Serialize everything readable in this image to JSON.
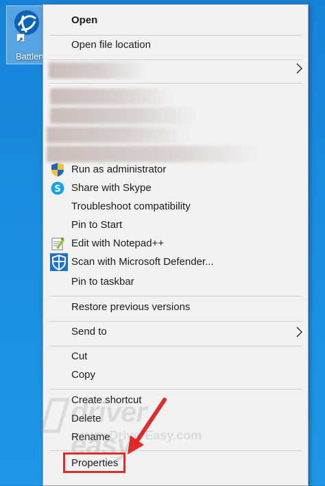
{
  "desktop": {
    "icon_label": "Battlenet"
  },
  "menu": {
    "open": "Open",
    "open_file_location": "Open file location",
    "run_as_admin": "Run as administrator",
    "share_skype": "Share with Skype",
    "troubleshoot": "Troubleshoot compatibility",
    "pin_start": "Pin to Start",
    "edit_notepad": "Edit with Notepad++",
    "scan_defender": "Scan with Microsoft Defender...",
    "pin_taskbar": "Pin to taskbar",
    "restore_versions": "Restore previous versions",
    "send_to": "Send to",
    "cut": "Cut",
    "copy": "Copy",
    "create_shortcut": "Create shortcut",
    "delete": "Delete",
    "rename": "Rename",
    "properties": "Properties"
  },
  "watermark": {
    "brand": "driver easy",
    "url": "www.DriverEasy.com"
  },
  "colors": {
    "highlight": "#e02a2a",
    "menu_bg": "#f2f2f2",
    "desktop": "#1a8fdf"
  }
}
